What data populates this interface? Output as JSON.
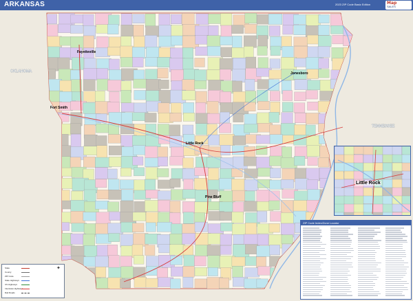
{
  "title": "ARKANSAS",
  "edition": "2023 ZIP Code Basic Edition",
  "logo": {
    "line1": "Map",
    "line2": "SALES"
  },
  "inset": {
    "label": "Little Rock"
  },
  "index": {
    "header": "ZIP Code Index/Zone Locator"
  },
  "cities": {
    "fayetteville": "Fayetteville",
    "jonesboro": "Jonesboro",
    "fort_smith": "Fort Smith",
    "pine_bluff": "Pine Bluff",
    "little_rock_main": "Little Rock"
  },
  "legend": {
    "items": [
      "State",
      "County",
      "ZIP Code",
      "State Highways",
      "US Highways",
      "Interstate Highways",
      "Rail Roads"
    ]
  },
  "colors": {
    "title_bar": "#3f62a8",
    "background": "#f4f1ea",
    "zip_fills": [
      "#bfe6f0",
      "#f6c9d9",
      "#c9e8b9",
      "#f7e3b0",
      "#d9c9ef",
      "#b8e6d5",
      "#f4d4b7",
      "#cfd7f1",
      "#e8f1b6",
      "#c7c2b8"
    ]
  }
}
